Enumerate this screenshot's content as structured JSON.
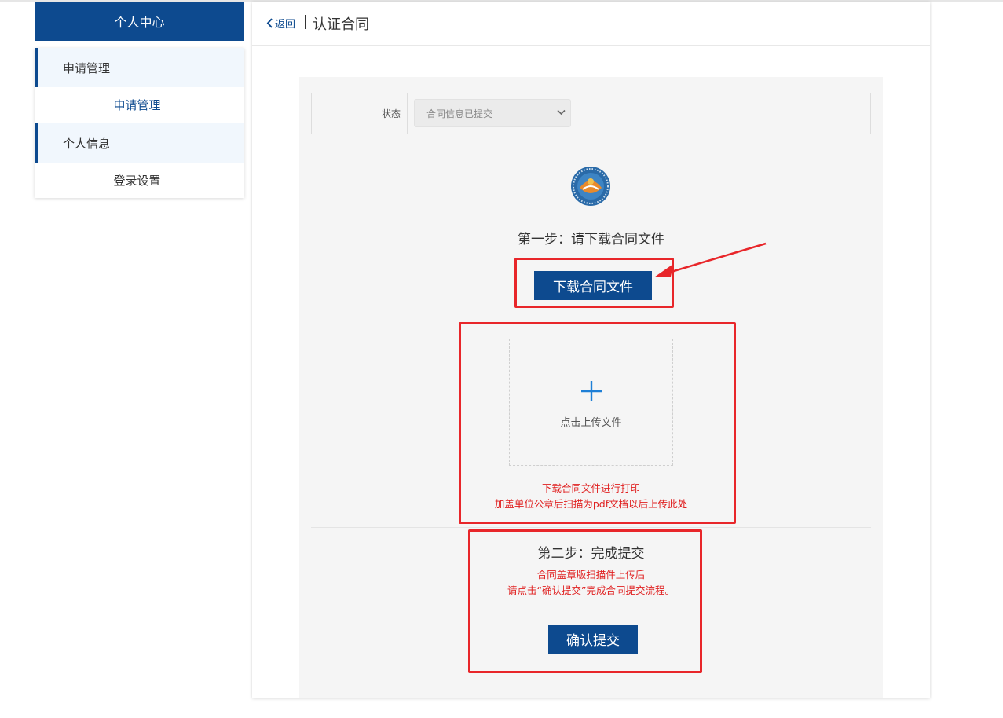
{
  "sidebar": {
    "title": "个人中心",
    "groups": [
      {
        "label": "申请管理",
        "sub": "申请管理"
      },
      {
        "label": "个人信息",
        "sub": "登录设置"
      }
    ]
  },
  "header": {
    "back_label": "返回",
    "title": "认证合同"
  },
  "status": {
    "label": "状态",
    "selected": "合同信息已提交"
  },
  "step1": {
    "title": "第一步：请下载合同文件",
    "download_label": "下载合同文件"
  },
  "upload": {
    "label": "点击上传文件",
    "note_line1": "下载合同文件进行打印",
    "note_line2": "加盖单位公章后扫描为pdf文档以后上传此处"
  },
  "step2": {
    "title": "第二步：完成提交",
    "note_line1": "合同盖章版扫描件上传后",
    "note_line2": "请点击“确认提交”完成合同提交流程。",
    "confirm_label": "确认提交"
  },
  "colors": {
    "primary": "#0d4a8f",
    "annotation": "#e8262a",
    "note_text": "#e02020"
  },
  "icons": {
    "back": "chevron-left-icon",
    "select": "chevron-down-icon",
    "upload": "plus-icon",
    "logo": "organization-logo-icon"
  }
}
